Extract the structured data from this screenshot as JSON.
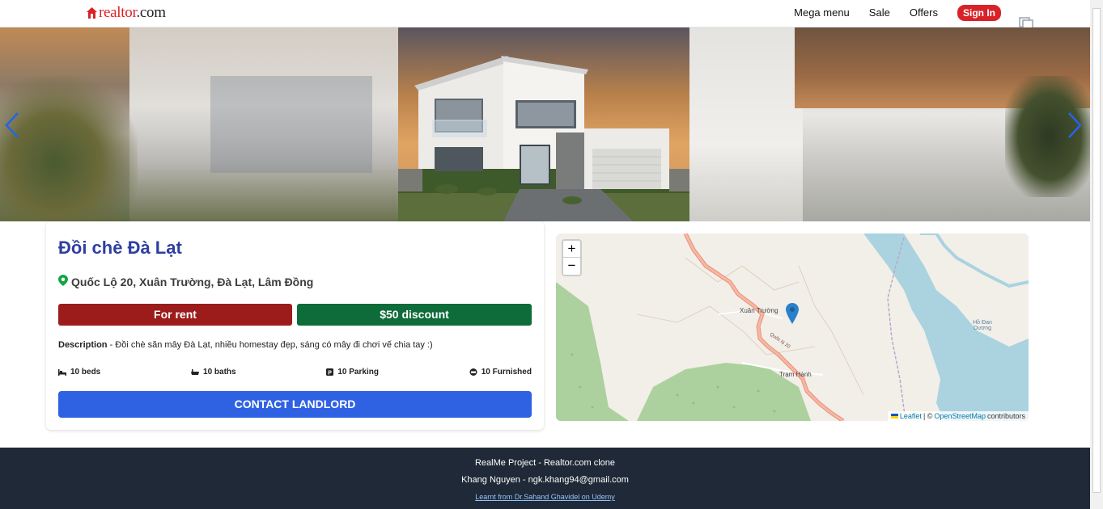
{
  "header": {
    "logo_text": "realtor.com",
    "nav": {
      "mega_menu": "Mega menu",
      "sale": "Sale",
      "offers": "Offers",
      "sign_in": "Sign In"
    }
  },
  "listing": {
    "title": "Đồi chè Đà Lạt",
    "address": "Quốc Lộ 20, Xuân Trường, Đà Lạt, Lâm Đồng",
    "badges": {
      "type": "For rent",
      "discount": "$50 discount"
    },
    "description_label": "Description",
    "description": " - Đồi chè săn mây Đà Lạt, nhiều homestay đẹp, sáng có mây đi chơi vế chia tay :)",
    "amenities": {
      "beds": "10 beds",
      "baths": "10 baths",
      "parking": "10 Parking",
      "furnished": "10 Furnished"
    },
    "contact_button": "CONTACT LANDLORD"
  },
  "map": {
    "zoom_in": "+",
    "zoom_out": "−",
    "labels": {
      "xuan_truong": "Xuân Trường",
      "tram_hanh": "Trạm Hành",
      "ho_dan_duong": "Hồ Đan Dương",
      "road": "Quốc lộ 20"
    },
    "attribution": {
      "leaflet": "Leaflet",
      "sep": "| ©",
      "osm": "OpenStreetMap",
      "contributors": "contributors"
    }
  },
  "footer": {
    "line1": "RealMe Project - Realtor.com clone",
    "line2": "Khang Nguyen - ngk.khang94@gmail.com",
    "link": "Learnt from Dr.Sahand Ghavidel on Udemy"
  },
  "colors": {
    "brand_red": "#d92228",
    "rent": "#9c1c1c",
    "discount": "#0e6b3a",
    "contact": "#2f62e3",
    "title": "#2e3fa0",
    "footer_bg": "#1f2937"
  },
  "icons": [
    "house-logo-icon",
    "copy-icon",
    "chevron-left-icon",
    "chevron-right-icon",
    "map-pin-icon",
    "bed-icon",
    "bath-icon",
    "parking-icon",
    "sofa-icon",
    "map-marker-icon",
    "ukraine-flag-icon"
  ]
}
